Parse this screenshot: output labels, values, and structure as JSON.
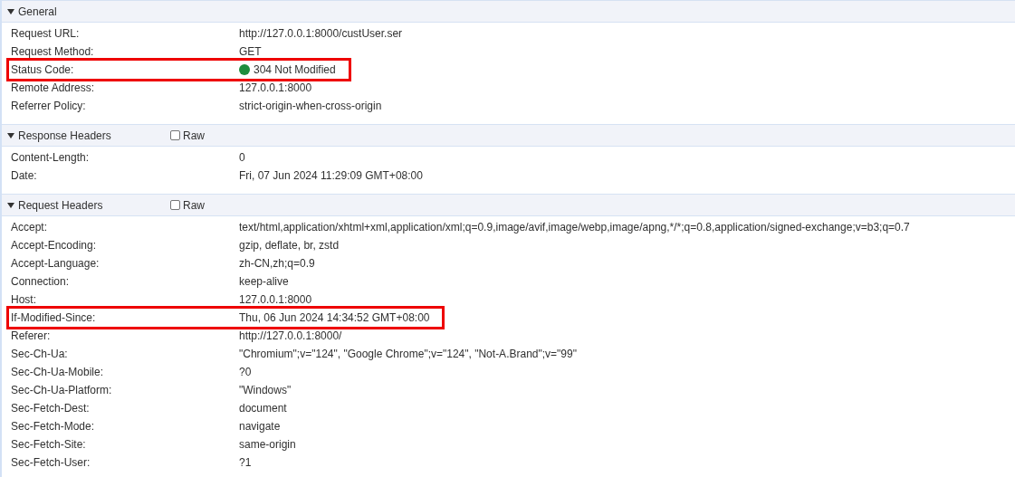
{
  "sections": [
    {
      "title": "General",
      "expanded": true,
      "rows": [
        {
          "name": "Request URL:",
          "value": "http://127.0.0.1:8000/custUser.ser",
          "highlighted": false
        },
        {
          "name": "Request Method:",
          "value": "GET",
          "highlighted": false
        },
        {
          "name": "Status Code:",
          "value": "304 Not Modified",
          "highlighted": true,
          "color": "#1e8e3e"
        },
        {
          "name": "Remote Address:",
          "value": "127.0.0.1:8000",
          "highlighted": false
        },
        {
          "name": "Referrer Policy:",
          "value": "strict-origin-when-cross-origin",
          "highlighted": false
        }
      ]
    },
    {
      "title": "Response Headers",
      "expanded": true,
      "raw": {
        "label": "Raw",
        "checked": false
      },
      "rows": [
        {
          "name": "Content-Length:",
          "value": "0",
          "highlighted": false
        },
        {
          "name": "Date:",
          "value": "Fri, 07 Jun 2024 11:29:09 GMT+08:00",
          "highlighted": false
        }
      ]
    },
    {
      "title": "Request Headers",
      "expanded": true,
      "raw": {
        "label": "Raw",
        "checked": false
      },
      "rows": [
        {
          "name": "Accept:",
          "value": "text/html,application/xhtml+xml,application/xml;q=0.9,image/avif,image/webp,image/apng,*/*;q=0.8,application/signed-exchange;v=b3;q=0.7",
          "highlighted": false
        },
        {
          "name": "Accept-Encoding:",
          "value": "gzip, deflate, br, zstd",
          "highlighted": false
        },
        {
          "name": "Accept-Language:",
          "value": "zh-CN,zh;q=0.9",
          "highlighted": false
        },
        {
          "name": "Connection:",
          "value": "keep-alive",
          "highlighted": false
        },
        {
          "name": "Host:",
          "value": "127.0.0.1:8000",
          "highlighted": false
        },
        {
          "name": "If-Modified-Since:",
          "value": "Thu, 06 Jun 2024 14:34:52 GMT+08:00",
          "highlighted": true
        },
        {
          "name": "Referer:",
          "value": "http://127.0.0.1:8000/",
          "highlighted": false
        },
        {
          "name": "Sec-Ch-Ua:",
          "value": "\"Chromium\";v=\"124\", \"Google Chrome\";v=\"124\", \"Not-A.Brand\";v=\"99\"",
          "highlighted": false
        },
        {
          "name": "Sec-Ch-Ua-Mobile:",
          "value": "?0",
          "highlighted": false
        },
        {
          "name": "Sec-Ch-Ua-Platform:",
          "value": "\"Windows\"",
          "highlighted": false
        },
        {
          "name": "Sec-Fetch-Dest:",
          "value": "document",
          "highlighted": false
        },
        {
          "name": "Sec-Fetch-Mode:",
          "value": "navigate",
          "highlighted": false
        },
        {
          "name": "Sec-Fetch-Site:",
          "value": "same-origin",
          "highlighted": false
        },
        {
          "name": "Sec-Fetch-User:",
          "value": "?1",
          "highlighted": false
        }
      ]
    }
  ]
}
